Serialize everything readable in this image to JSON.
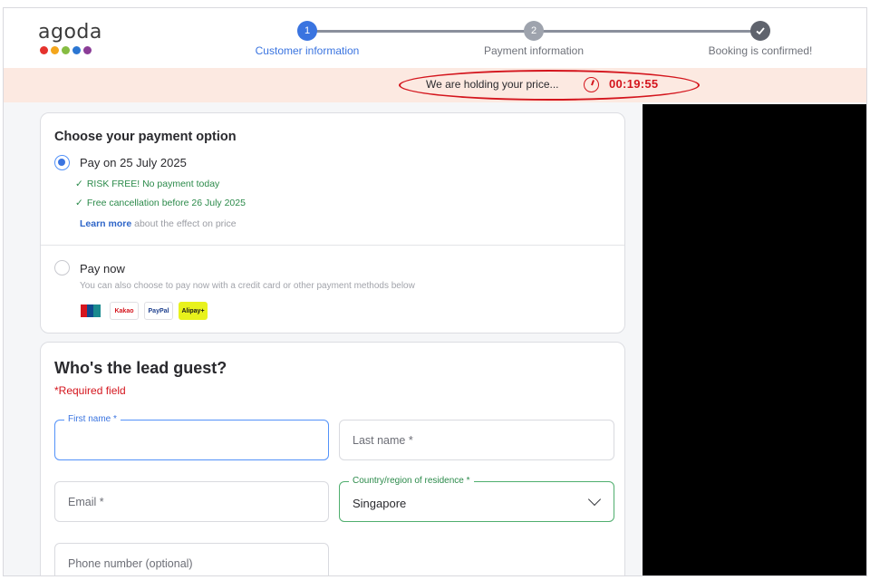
{
  "brand": {
    "name": "agoda",
    "dot_colors": [
      "#e5322d",
      "#f4a61b",
      "#86bc42",
      "#2b76d2",
      "#8b3d97"
    ]
  },
  "steps": [
    {
      "number": "1",
      "label": "Customer information",
      "state": "active"
    },
    {
      "number": "2",
      "label": "Payment information",
      "state": "inactive"
    },
    {
      "icon": "check-icon",
      "label": "Booking is confirmed!",
      "state": "inactive"
    }
  ],
  "banner": {
    "text": "We are holding your price...",
    "timer": "00:19:55",
    "icon": "clock-icon"
  },
  "payment": {
    "title": "Choose your payment option",
    "options": [
      {
        "label": "Pay on 25 July 2025",
        "selected": true,
        "benefits": [
          "RISK FREE! No payment today",
          "Free cancellation before 26 July 2025"
        ],
        "learn_more": "Learn more",
        "learn_more_suffix": "about the effect on price"
      },
      {
        "label": "Pay now",
        "selected": false,
        "subtext": "You can also choose to pay now with a credit card or other payment methods below"
      }
    ],
    "methods": [
      "UnionPay",
      "Kakao",
      "PayPal",
      "Alipay+"
    ]
  },
  "guest": {
    "title": "Who's the lead guest?",
    "required": "*Required field",
    "fields": {
      "first_name": "First name *",
      "last_name": "Last name *",
      "email": "Email *",
      "country_label": "Country/region of residence *",
      "country_value": "Singapore",
      "phone": "Phone number (optional)"
    }
  }
}
